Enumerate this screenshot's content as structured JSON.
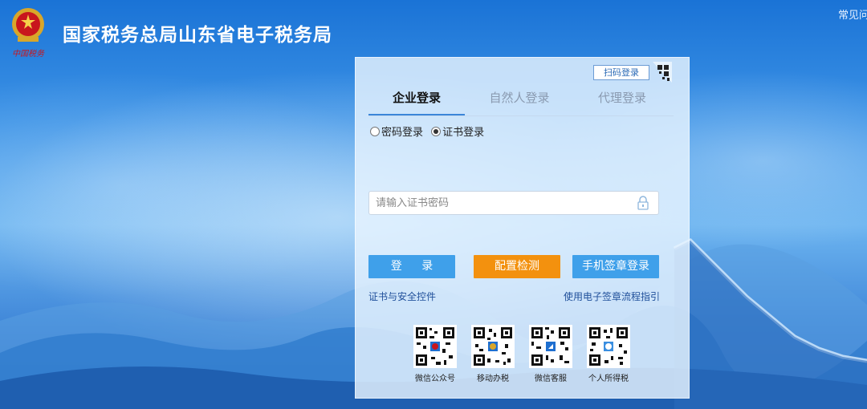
{
  "header": {
    "title": "国家税务总局山东省电子税务局",
    "help_link": "常见问题"
  },
  "panel": {
    "scan_login": "扫码登录",
    "tabs": [
      {
        "label": "企业登录"
      },
      {
        "label": "自然人登录"
      },
      {
        "label": "代理登录"
      }
    ],
    "radios": [
      {
        "label": "密码登录",
        "checked": false
      },
      {
        "label": "证书登录",
        "checked": true
      }
    ],
    "password_placeholder": "请输入证书密码",
    "buttons": {
      "login": "登 录",
      "config_check": "配置检测",
      "mobile_sign": "手机签章登录"
    },
    "links": {
      "cert_control": "证书与安全控件",
      "sign_guide": "使用电子签章流程指引"
    },
    "qr_codes": [
      {
        "label": "微信公众号"
      },
      {
        "label": "移动办税"
      },
      {
        "label": "微信客服"
      },
      {
        "label": "个人所得税"
      }
    ]
  },
  "colors": {
    "accent_blue": "#3fa0ea",
    "accent_orange": "#f3910e",
    "link_blue": "#1f4f9a"
  }
}
